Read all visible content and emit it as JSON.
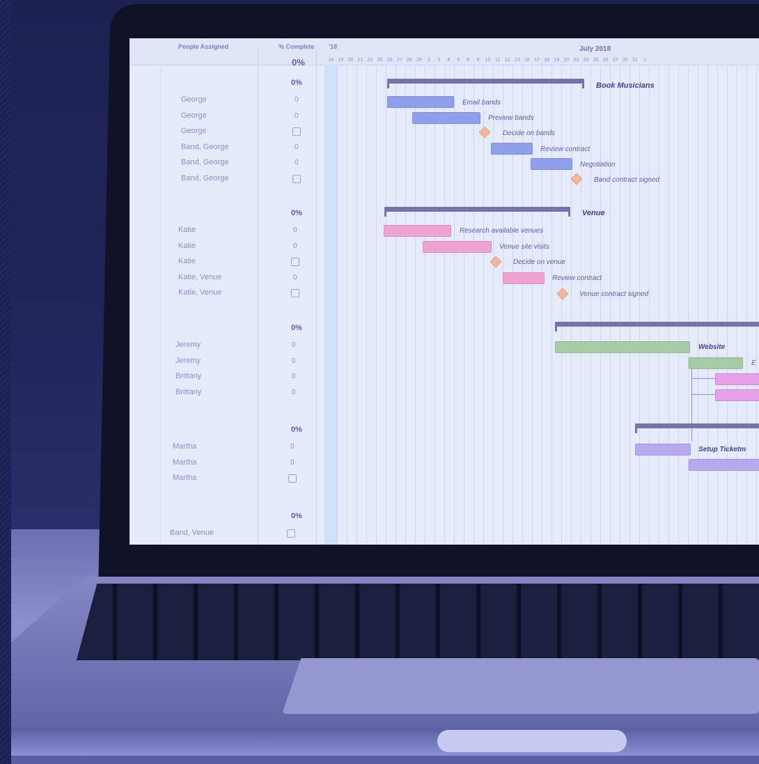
{
  "header": {
    "people_col": "People Assigned",
    "complete_col": "% Complete",
    "year_fragment": "'18",
    "month": "July 2018",
    "days": [
      "18",
      "19",
      "20",
      "21",
      "22",
      "25",
      "26",
      "27",
      "28",
      "29",
      "2",
      "3",
      "4",
      "5",
      "6",
      "9",
      "10",
      "11",
      "12",
      "13",
      "16",
      "17",
      "18",
      "19",
      "20",
      "23",
      "24",
      "25",
      "26",
      "27",
      "30",
      "31",
      "1"
    ],
    "total_pct": "0%"
  },
  "groups": [
    {
      "pct": "0%",
      "rows": [
        {
          "name": "George",
          "val": "0"
        },
        {
          "name": "George",
          "val": "0"
        },
        {
          "name": "George",
          "val": "checkbox"
        },
        {
          "name": "Band, George",
          "val": "0"
        },
        {
          "name": "Band, George",
          "val": "0"
        },
        {
          "name": "Band, George",
          "val": "checkbox"
        }
      ]
    },
    {
      "pct": "0%",
      "rows": [
        {
          "name": "Katie",
          "val": "0"
        },
        {
          "name": "Katie",
          "val": "0"
        },
        {
          "name": "Katie",
          "val": "checkbox"
        },
        {
          "name": "Katie, Venue",
          "val": "0"
        },
        {
          "name": "Katie, Venue",
          "val": "checkbox"
        }
      ]
    },
    {
      "pct": "0%",
      "rows": [
        {
          "name": "Jeremy",
          "val": "0"
        },
        {
          "name": "Jeremy",
          "val": "0"
        },
        {
          "name": "Brittany",
          "val": "0"
        },
        {
          "name": "Brittany",
          "val": "0"
        }
      ]
    },
    {
      "pct": "0%",
      "rows": [
        {
          "name": "Martha",
          "val": "0"
        },
        {
          "name": "Martha",
          "val": "0"
        },
        {
          "name": "Martha",
          "val": "checkbox"
        }
      ]
    },
    {
      "pct": "0%",
      "rows": [
        {
          "name": "Band, Venue",
          "val": "checkbox"
        }
      ]
    }
  ],
  "tasks": {
    "book_musicians": "Book Musicians",
    "email_bands": "Email bands",
    "preview_bands": "Preview bands",
    "decide_bands": "Decide on bands",
    "review_contract_1": "Review contract",
    "negotiation": "Negotiation",
    "band_contract": "Band contract signed",
    "venue": "Venue",
    "research_venues": "Research available venues",
    "venue_site_visits": "Venue site visits",
    "decide_venue": "Decide on venue",
    "review_contract_2": "Review contract",
    "venue_contract": "Venue contract signed",
    "website": "Website",
    "setup_ticketing": "Setup Ticketm",
    "e_fragment": "E"
  },
  "colors": {
    "band_bars": "#8f9fea",
    "venue_bars": "#eda4d0",
    "website_bars": "#a7cba6",
    "milestone": "#f2b79a",
    "summary": "#7077a8"
  }
}
